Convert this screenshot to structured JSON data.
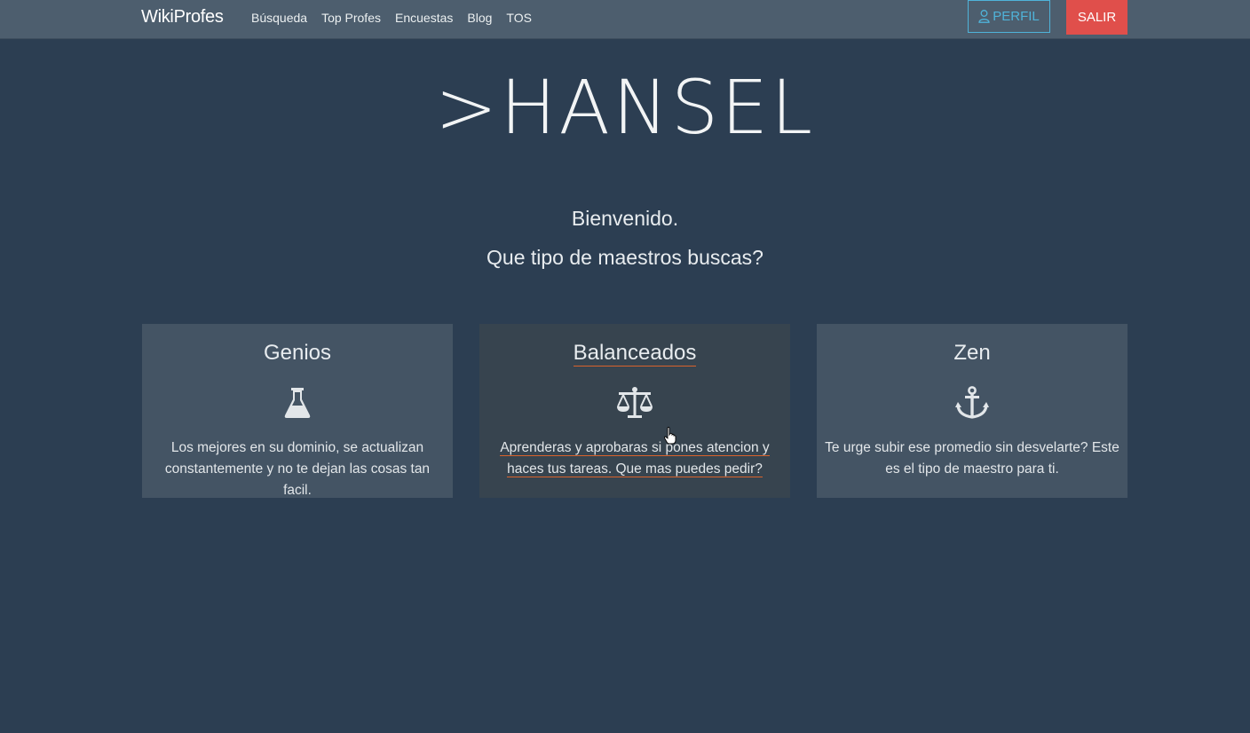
{
  "navbar": {
    "brand": "WikiProfes",
    "links": [
      "Búsqueda",
      "Top Profes",
      "Encuestas",
      "Blog",
      "TOS"
    ],
    "perfil_label": "PERFIL",
    "salir_label": "SALIR",
    "perfil_icon": "user-icon"
  },
  "hero": {
    "title": ">HANSEL",
    "welcome": "Bienvenido.",
    "question": "Que tipo de maestros buscas?"
  },
  "cards": [
    {
      "title": "Genios",
      "icon": "flask-icon",
      "description": "Los mejores en su dominio, se actualizan constantemente y no te dejan las cosas tan facil."
    },
    {
      "title": "Balanceados",
      "icon": "balance-scale-icon",
      "description": "Aprenderas y aprobaras si pones atencion y haces tus tareas. Que mas puedes pedir?"
    },
    {
      "title": "Zen",
      "icon": "anchor-icon",
      "description": "Te urge subir ese promedio sin desvelarte? Este es el tipo de maestro para ti."
    }
  ],
  "colors": {
    "background": "#2c3e52",
    "navbar": "#4d5e6e",
    "card": "#445464",
    "card_hover": "#37444f",
    "accent_info": "#4fb3d9",
    "accent_danger": "#e04f4b"
  }
}
